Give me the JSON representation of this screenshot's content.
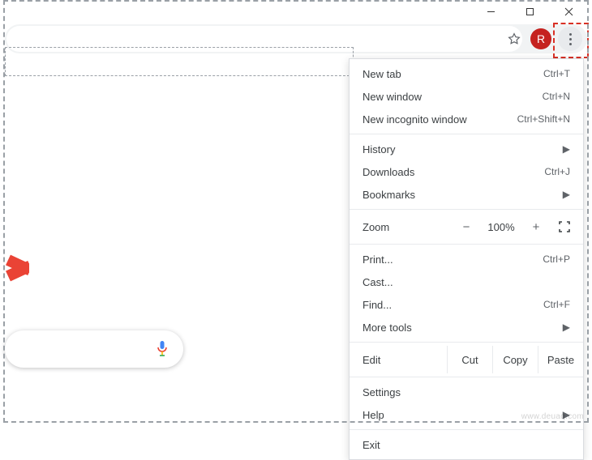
{
  "window_controls": {
    "minimize": "minimize",
    "maximize": "maximize",
    "close": "close"
  },
  "toolbar": {
    "bookmark_icon": "star",
    "avatar_letter": "R",
    "menu_icon": "more-vert"
  },
  "menu": {
    "new_tab": {
      "label": "New tab",
      "shortcut": "Ctrl+T"
    },
    "new_window": {
      "label": "New window",
      "shortcut": "Ctrl+N"
    },
    "new_incognito": {
      "label": "New incognito window",
      "shortcut": "Ctrl+Shift+N"
    },
    "history": {
      "label": "History"
    },
    "downloads": {
      "label": "Downloads",
      "shortcut": "Ctrl+J"
    },
    "bookmarks": {
      "label": "Bookmarks"
    },
    "zoom": {
      "label": "Zoom",
      "value": "100%",
      "minus": "−",
      "plus": "+"
    },
    "print": {
      "label": "Print...",
      "shortcut": "Ctrl+P"
    },
    "cast": {
      "label": "Cast..."
    },
    "find": {
      "label": "Find...",
      "shortcut": "Ctrl+F"
    },
    "more_tools": {
      "label": "More tools"
    },
    "edit": {
      "label": "Edit",
      "cut": "Cut",
      "copy": "Copy",
      "paste": "Paste"
    },
    "settings": {
      "label": "Settings"
    },
    "help": {
      "label": "Help"
    },
    "exit": {
      "label": "Exit"
    }
  },
  "watermark": "www.deuaq.com"
}
